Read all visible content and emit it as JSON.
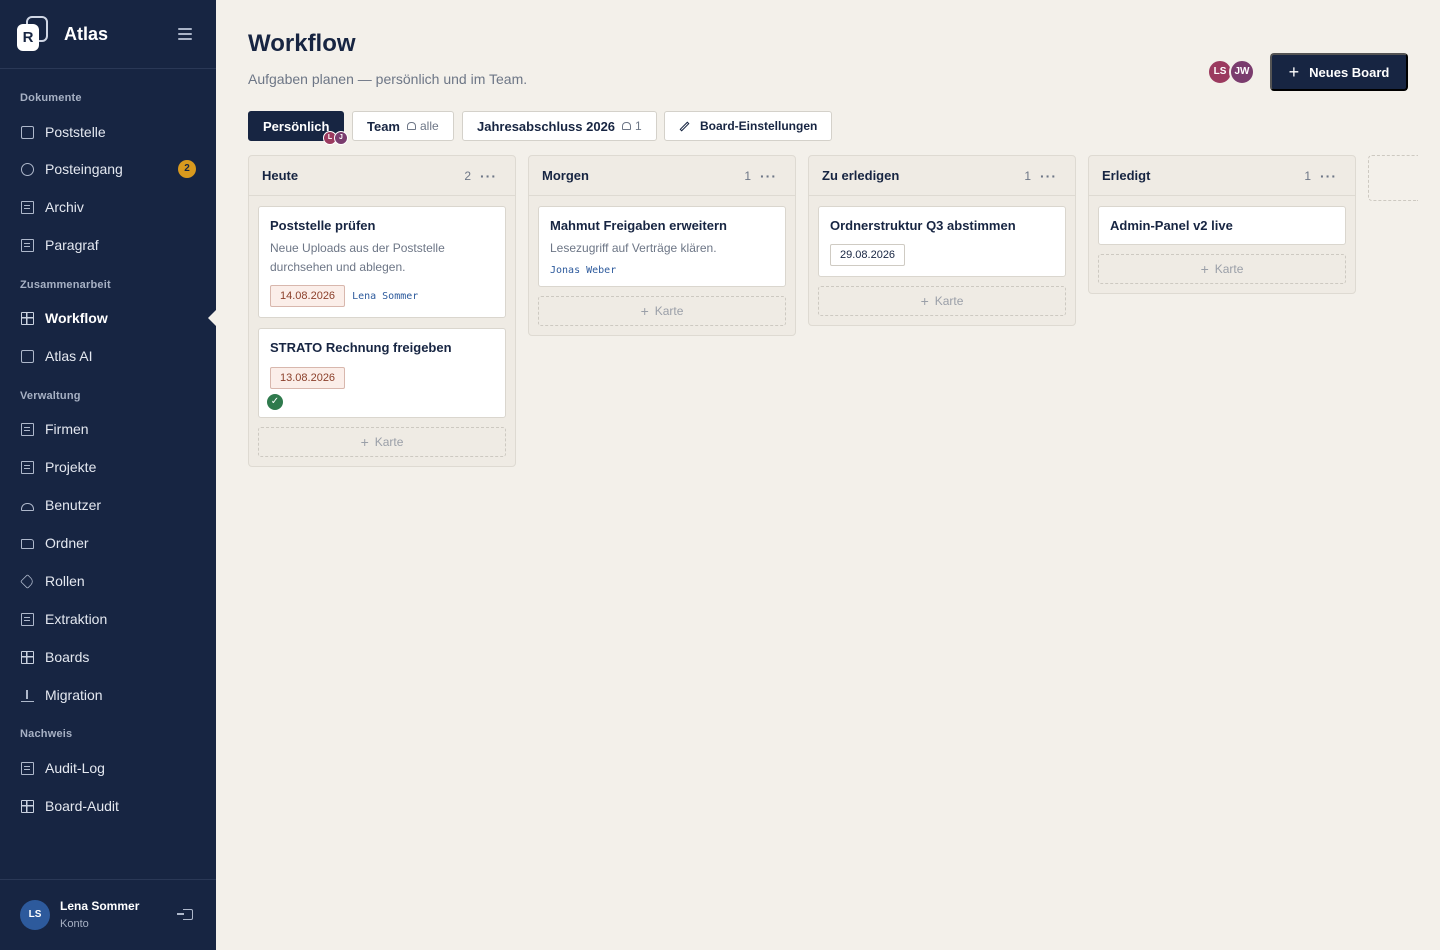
{
  "app": {
    "name": "Atlas",
    "logo_letter": "R"
  },
  "sidebar": {
    "sections": [
      {
        "label": "Dokumente",
        "items": [
          {
            "label": "Poststelle",
            "icon": "inbox-icon"
          },
          {
            "label": "Posteingang",
            "icon": "clock-icon",
            "badge": "2"
          },
          {
            "label": "Archiv",
            "icon": "archive-icon"
          },
          {
            "label": "Paragraf",
            "icon": "paragraph-icon"
          }
        ]
      },
      {
        "label": "Zusammenarbeit",
        "items": [
          {
            "label": "Workflow",
            "icon": "board-icon",
            "active": true
          },
          {
            "label": "Atlas AI",
            "icon": "robot-icon"
          }
        ]
      },
      {
        "label": "Verwaltung",
        "items": [
          {
            "label": "Firmen",
            "icon": "building-icon"
          },
          {
            "label": "Projekte",
            "icon": "building-icon"
          },
          {
            "label": "Benutzer",
            "icon": "users-icon"
          },
          {
            "label": "Ordner",
            "icon": "folder-icon"
          },
          {
            "label": "Rollen",
            "icon": "tag-icon"
          },
          {
            "label": "Extraktion",
            "icon": "sliders-icon"
          },
          {
            "label": "Boards",
            "icon": "board-icon"
          },
          {
            "label": "Migration",
            "icon": "upload-icon"
          }
        ]
      },
      {
        "label": "Nachweis",
        "items": [
          {
            "label": "Audit-Log",
            "icon": "log-icon"
          },
          {
            "label": "Board-Audit",
            "icon": "board-icon"
          }
        ]
      }
    ],
    "user": {
      "initials": "LS",
      "name": "Lena Sommer",
      "sub": "Konto"
    }
  },
  "header": {
    "title": "Workflow",
    "subtitle": "Aufgaben planen — persönlich und im Team.",
    "avatars": [
      "LS",
      "JW"
    ],
    "new_board_label": "Neues Board",
    "new_board_icon": "+"
  },
  "tabs": {
    "personal": {
      "label": "Persönlich",
      "avatars": [
        "L",
        "J"
      ]
    },
    "team": {
      "label": "Team",
      "suffix": "alle"
    },
    "year": {
      "label": "Jahresabschluss 2026",
      "count": "1"
    },
    "settings": {
      "label": "Board-Einstellungen"
    }
  },
  "columns": [
    {
      "title": "Heute",
      "count": "2",
      "more": "···",
      "add_label": "Karte",
      "cards": [
        {
          "title": "Poststelle prüfen",
          "desc": "Neue Uploads aus der Poststelle durchsehen und ablegen.",
          "date": "14.08.2026",
          "assignee": "Lena Sommer"
        },
        {
          "title": "STRATO Rechnung freigeben",
          "date": "13.08.2026",
          "check": "✓"
        }
      ]
    },
    {
      "title": "Morgen",
      "count": "1",
      "more": "···",
      "add_label": "Karte",
      "cards": [
        {
          "title": "Mahmut Freigaben erweitern",
          "desc": "Lesezugriff auf Verträge klären.",
          "assignee": "Jonas Weber"
        }
      ]
    },
    {
      "title": "Zu erledigen",
      "count": "1",
      "more": "···",
      "add_label": "Karte",
      "cards": [
        {
          "title": "Ordnerstruktur Q3 abstimmen",
          "date": "29.08.2026"
        }
      ]
    },
    {
      "title": "Erledigt",
      "count": "1",
      "more": "···",
      "add_label": "Karte",
      "cards": [
        {
          "title": "Admin-Panel v2 live"
        }
      ]
    }
  ],
  "colors": {
    "sidebar": "#172542",
    "accent": "#172542",
    "badge": "#d99a1e",
    "overdue": "#8b3f2a",
    "done": "#2f7a4d"
  }
}
